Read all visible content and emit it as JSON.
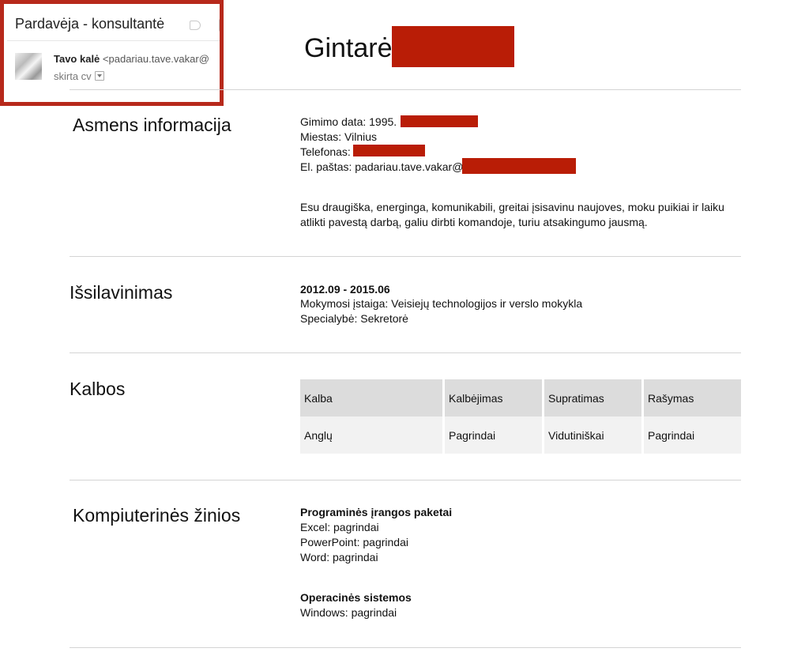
{
  "email": {
    "subject": "Pardavėja - konsultantė",
    "sender_name": "Tavo kalė",
    "sender_address": "<padariau.tave.vakar@",
    "to_line": "skirta cv"
  },
  "cv": {
    "name": "Gintarė",
    "sections": {
      "personal": {
        "title": "Asmens informacija",
        "birth": "Gimimo data: 1995.",
        "city": "Miestas: Vilnius",
        "phone": "Telefonas:",
        "email": "El. paštas: padariau.tave.vakar@",
        "description": "Esu draugiška, energinga, komunikabili, greitai įsisavinu naujoves, moku puikiai ir laiku atlikti pavestą darbą, galiu dirbti komandoje, turiu atsakingumo jausmą."
      },
      "education": {
        "title": "Išsilavinimas",
        "period": "2012.09 - 2015.06",
        "institution": "Mokymosi įstaiga: Veisiejų technologijos ir verslo mokykla",
        "specialty": "Specialybė: Sekretorė"
      },
      "languages": {
        "title": "Kalbos",
        "headers": [
          "Kalba",
          "Kalbėjimas",
          "Supratimas",
          "Rašymas"
        ],
        "row": [
          "Anglų",
          "Pagrindai",
          "Vidutiniškai",
          "Pagrindai"
        ]
      },
      "computer": {
        "title": "Kompiuterinės žinios",
        "software_heading": "Programinės įrangos paketai",
        "software": [
          "Excel: pagrindai",
          "PowerPoint: pagrindai",
          "Word: pagrindai"
        ],
        "os_heading": "Operacinės sistemos",
        "os": [
          "Windows: pagrindai"
        ]
      }
    }
  },
  "colors": {
    "redaction": "#b91d06",
    "frame": "#b7291b"
  }
}
